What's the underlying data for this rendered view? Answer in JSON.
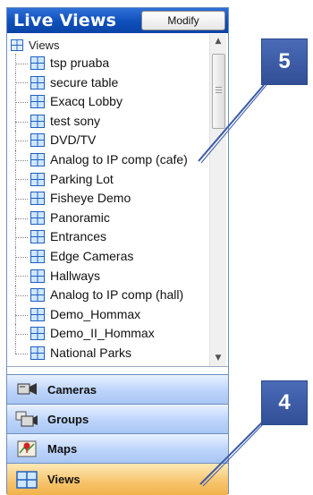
{
  "header": {
    "title": "Live Views",
    "modify_label": "Modify"
  },
  "tree": {
    "root_label": "Views",
    "items": [
      "tsp pruaba",
      "secure table",
      "Exacq Lobby",
      "test sony",
      "DVD/TV",
      "Analog to IP comp (cafe)",
      "Parking Lot",
      "Fisheye Demo",
      "Panoramic",
      "Entrances",
      "Edge Cameras",
      "Hallways",
      "Analog to IP comp (hall)",
      "Demo_Hommax",
      "Demo_II_Hommax",
      "National Parks"
    ]
  },
  "nav": {
    "cameras": "Cameras",
    "groups": "Groups",
    "maps": "Maps",
    "views": "Views",
    "active": "views"
  },
  "callouts": {
    "top": "5",
    "bottom": "4"
  },
  "colors": {
    "header": "#0e4fba",
    "callout": "#3a5aa7",
    "nav": "#bcd4fa",
    "nav_active": "#f7c670"
  }
}
